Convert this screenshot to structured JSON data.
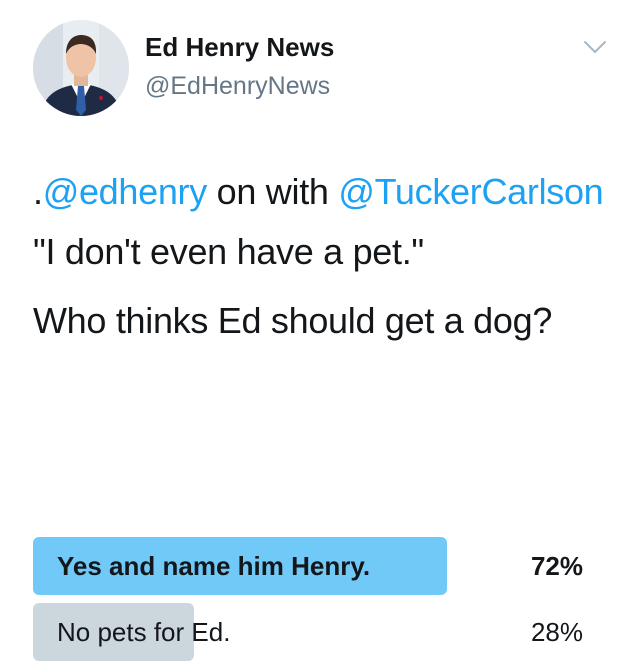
{
  "author": {
    "display_name": "Ed Henry News",
    "handle": "@EdHenryNews",
    "avatar_icon": "person-avatar-icon"
  },
  "menu": {
    "icon": "chevron-down-icon"
  },
  "tweet": {
    "p1_prefix": ".",
    "mention_1": "@edhenry",
    "p1_mid": " on with ",
    "mention_2": "@TuckerCarlson",
    "p1_suffix": "  \"I don't even have a pet.\"",
    "p2": "Who thinks Ed should get a dog?"
  },
  "poll": {
    "options": [
      {
        "label": "Yes and name him Henry.",
        "percent_label": "72%",
        "percent": 72,
        "winner": true
      },
      {
        "label": "No pets for Ed.",
        "percent_label": "28%",
        "percent": 28,
        "winner": false
      }
    ]
  },
  "colors": {
    "link": "#1da1f2",
    "winner_bar": "#71c9f8",
    "loser_bar": "#ccd6dd",
    "secondary_text": "#657786"
  }
}
